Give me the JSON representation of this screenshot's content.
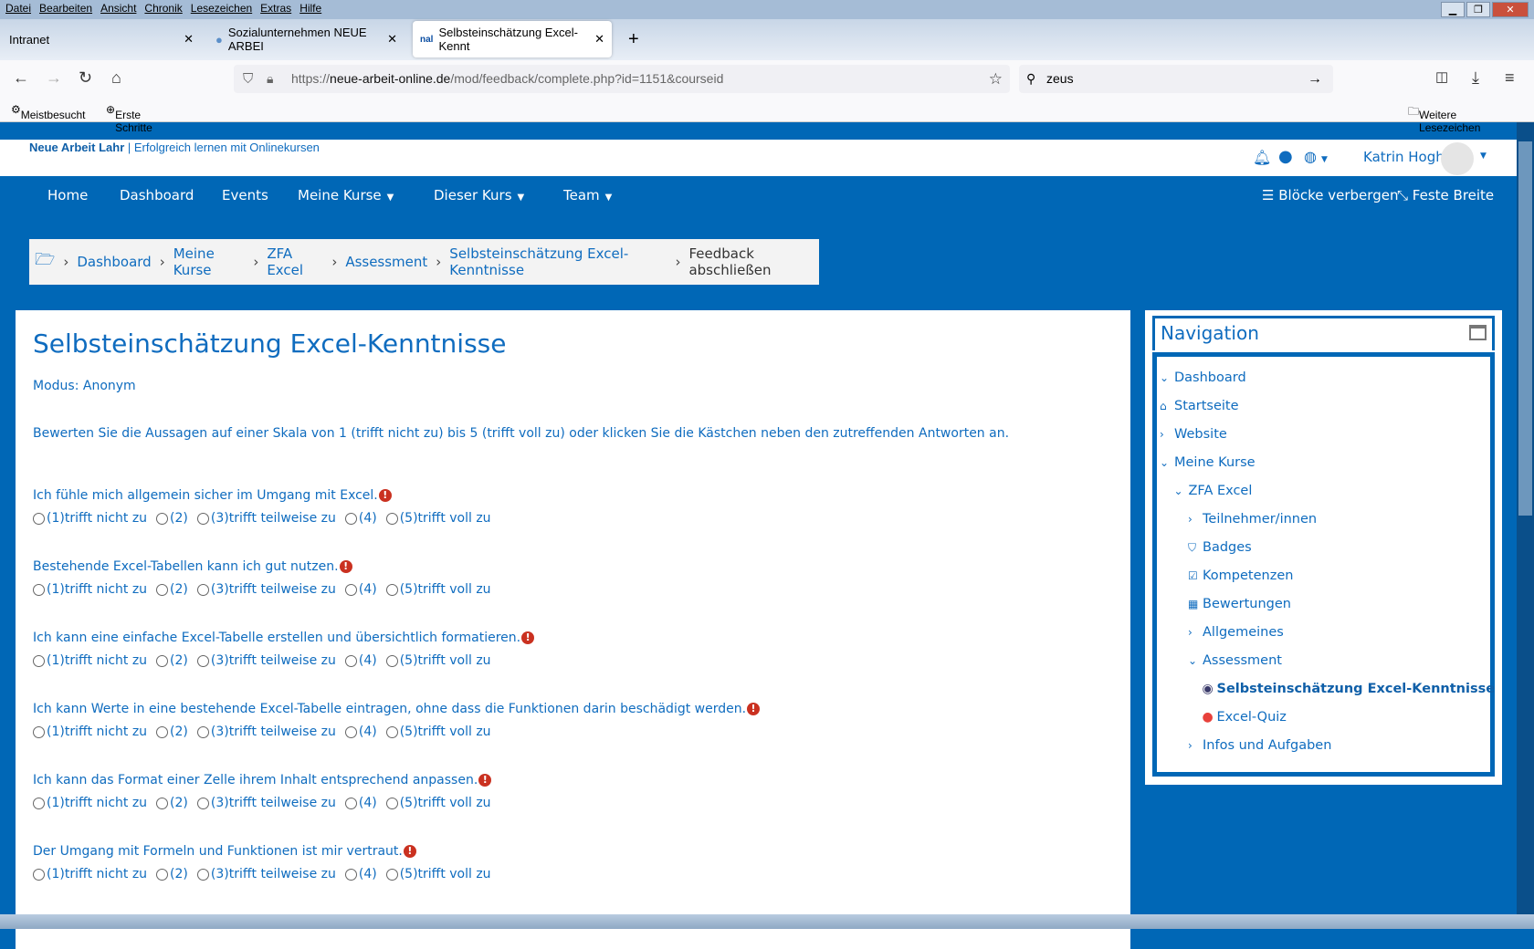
{
  "browser": {
    "menu": [
      "Datei",
      "Bearbeiten",
      "Ansicht",
      "Chronik",
      "Lesezeichen",
      "Extras",
      "Hilfe"
    ],
    "tabs": [
      {
        "label": "Intranet"
      },
      {
        "label": "Sozialunternehmen NEUE ARBEI"
      },
      {
        "label": "Selbsteinschätzung Excel-Kennt"
      }
    ],
    "url_prefix": "https://",
    "url_host": "neue-arbeit-online.de",
    "url_path": "/mod/feedback/complete.php?id=1151&courseid",
    "search_value": "zeus",
    "bookmarks": [
      "Meistbesucht",
      "Erste Schritte"
    ],
    "bookmarks_more": "Weitere Lesezeichen"
  },
  "site": {
    "brand": "Neue Arbeit Lahr",
    "tagline": " | Erfolgreich lernen mit Onlinekursen",
    "user": "Katrin Hogh",
    "nav": [
      "Home",
      "Dashboard",
      "Events",
      "Meine Kurse",
      "Dieser Kurs",
      "Team"
    ],
    "hide_blocks": "Blöcke verbergen",
    "fixed_width": "Feste Breite",
    "accent": "#0f6cbf",
    "brand_blue": "#0067b6"
  },
  "breadcrumb": [
    "Dashboard",
    "Meine Kurse",
    "ZFA Excel",
    "Assessment",
    "Selbsteinschätzung Excel-Kenntnisse",
    "Feedback abschließen"
  ],
  "main": {
    "title": "Selbsteinschätzung Excel-Kenntnisse",
    "mode": "Modus: Anonym",
    "instructions": "Bewerten Sie die Aussagen auf einer Skala von 1 (trifft nicht zu) bis 5 (trifft voll zu) oder klicken Sie die Kästchen neben den zutreffenden Antworten an.",
    "options": [
      "(1)trifft nicht zu",
      "(2)",
      "(3)trifft teilweise zu",
      "(4)",
      "(5)trifft voll zu"
    ],
    "questions": [
      "Ich fühle mich allgemein sicher im Umgang mit Excel.",
      "Bestehende Excel-Tabellen kann ich gut nutzen.",
      "Ich kann eine einfache Excel-Tabelle erstellen und übersichtlich formatieren.",
      "Ich kann Werte in eine bestehende Excel-Tabelle eintragen, ohne dass die Funktionen darin beschädigt werden.",
      "Ich kann das Format einer Zelle ihrem Inhalt entsprechend anpassen.",
      "Der Umgang mit Formeln und Funktionen ist mir vertraut."
    ]
  },
  "navblock": {
    "title": "Navigation",
    "items": [
      "Dashboard",
      "Startseite",
      "Website",
      "Meine Kurse",
      "ZFA Excel",
      "Teilnehmer/innen",
      "Badges",
      "Kompetenzen",
      "Bewertungen",
      "Allgemeines",
      "Assessment",
      "Selbsteinschätzung Excel-Kenntnisse",
      "Excel-Quiz",
      "Infos und Aufgaben"
    ]
  }
}
